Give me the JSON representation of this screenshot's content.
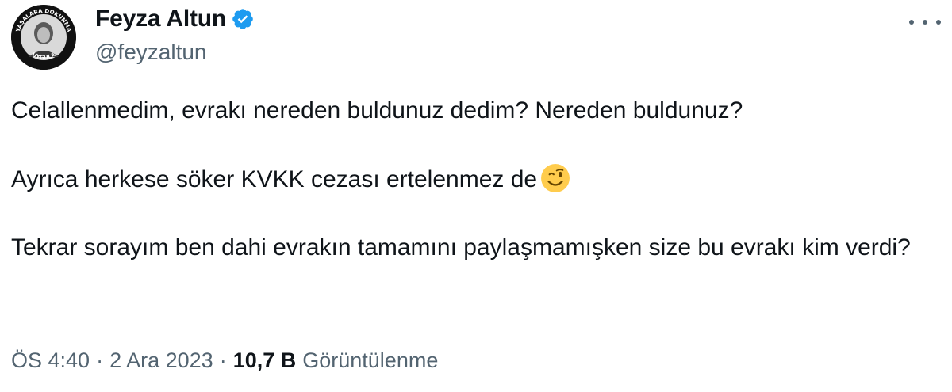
{
  "author": {
    "display_name": "Feyza Altun",
    "handle": "@feyzaltun",
    "avatar_badge_top": "YAŞALARA DOKUNMA",
    "avatar_badge_bottom": "UYGULA",
    "verified_icon": "verified-badge-icon",
    "verified_color": "#1d9bf0"
  },
  "tweet": {
    "paragraphs": [
      "Celallenmedim, evrakı nereden buldunuz dedim? Nereden buldunuz?",
      "Ayrıca herkese söker KVKK cezası ertelenmez de",
      "Tekrar sorayım ben dahi evrakın tamamını paylaşmamışken size bu evrakı kim verdi?"
    ],
    "emoji": "winking-face-emoji"
  },
  "meta": {
    "time": "ÖS 4:40",
    "separator": "·",
    "date": "2 Ara 2023",
    "views_count": "10,7 B",
    "views_label": "Görüntülenme"
  },
  "actions": {
    "more_icon": "more-horizontal-icon"
  }
}
